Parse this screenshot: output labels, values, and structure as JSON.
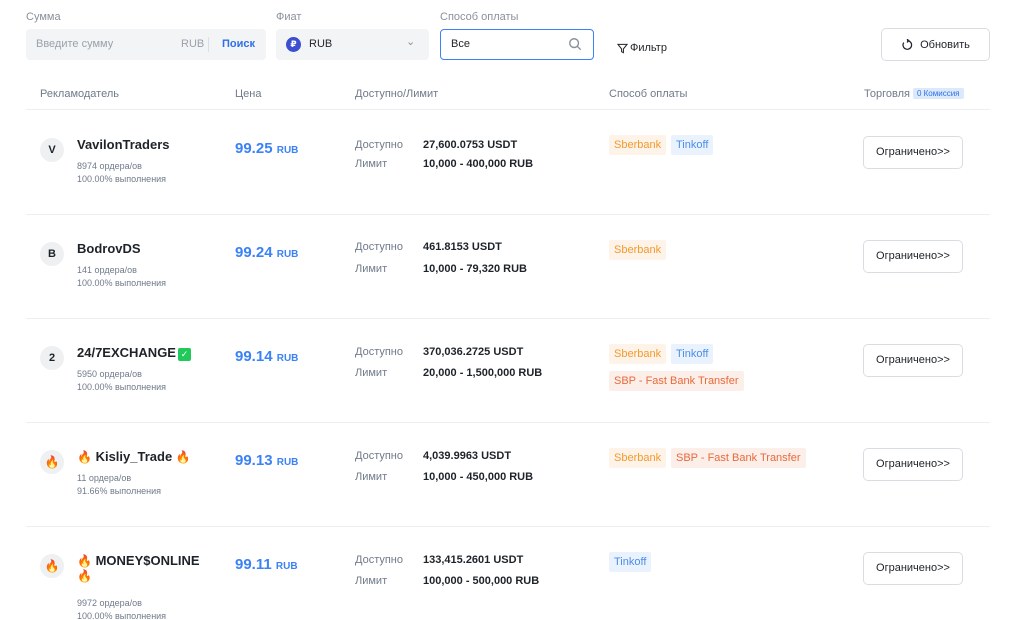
{
  "filters": {
    "amount_label": "Сумма",
    "amount_placeholder": "Введите сумму",
    "amount_unit": "RUB",
    "amount_search": "Поиск",
    "fiat_label": "Фиат",
    "fiat_value": "RUB",
    "fiat_icon": "₽",
    "payment_label": "Способ оплаты",
    "payment_value": "Все",
    "filter_link": "Фильтр",
    "refresh_label": "Обновить"
  },
  "table": {
    "col_advertiser": "Рекламодатель",
    "col_price": "Цена",
    "col_available": "Доступно/Лимит",
    "col_payment": "Способ оплаты",
    "col_trade": "Торговля",
    "fee_badge": "0 Комиссия"
  },
  "labels": {
    "available": "Доступно",
    "limit": "Лимит",
    "button": "Ограничено>>"
  },
  "rows": [
    {
      "avatar": "V",
      "name": "VavilonTraders",
      "orders": "8974 ордера/ов",
      "completion": "100.00% выполнения",
      "price": "99.25",
      "currency": "RUB",
      "available": "27,600.0753 USDT",
      "limit": "10,000 - 400,000 RUB",
      "payments": [
        "Sberbank",
        "Tinkoff"
      ]
    },
    {
      "avatar": "B",
      "name": "BodrovDS",
      "orders": "141 ордера/ов",
      "completion": "100.00% выполнения",
      "price": "99.24",
      "currency": "RUB",
      "available": "461.8153 USDT",
      "limit": "10,000 - 79,320 RUB",
      "payments": [
        "Sberbank"
      ]
    },
    {
      "avatar": "2",
      "name": "24/7EXCHANGE",
      "orders": "5950 ордера/ов",
      "completion": "100.00% выполнения",
      "price": "99.14",
      "currency": "RUB",
      "available": "370,036.2725 USDT",
      "limit": "20,000 - 1,500,000 RUB",
      "payments": [
        "Sberbank",
        "Tinkoff",
        "SBP - Fast Bank Transfer"
      ]
    },
    {
      "avatar": "🔥",
      "name": "Kisliy_Trade",
      "orders": "11 ордера/ов",
      "completion": "91.66% выполнения",
      "price": "99.13",
      "currency": "RUB",
      "available": "4,039.9963 USDT",
      "limit": "10,000 - 450,000 RUB",
      "payments": [
        "Sberbank",
        "SBP - Fast Bank Transfer"
      ]
    },
    {
      "avatar": "🔥",
      "name": "MONEY$ONLINE",
      "orders": "9972 ордера/ов",
      "completion": "100.00% выполнения",
      "price": "99.11",
      "currency": "RUB",
      "available": "133,415.2601 USDT",
      "limit": "100,000 - 500,000 RUB",
      "payments": [
        "Tinkoff"
      ]
    }
  ]
}
